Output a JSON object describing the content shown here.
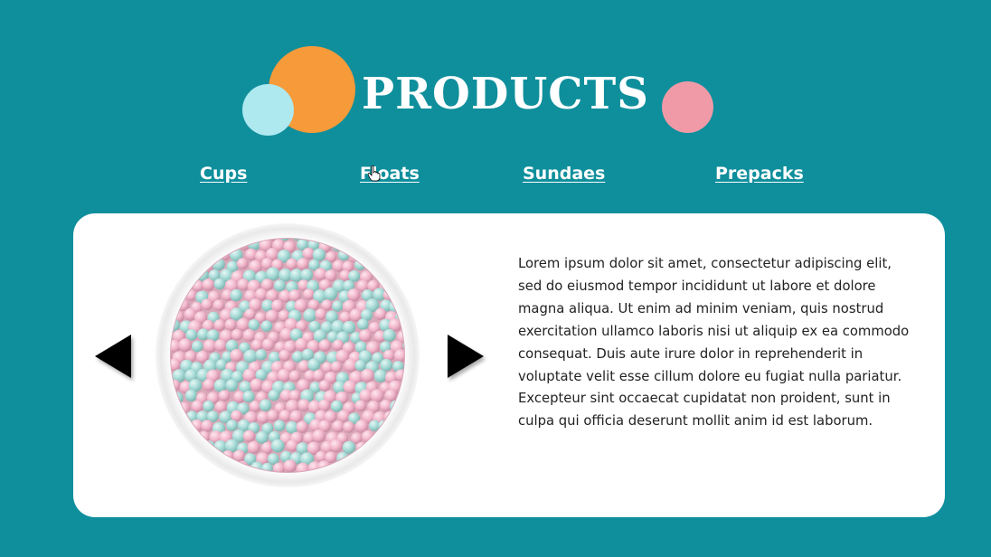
{
  "header": {
    "title": "PRODUCTS"
  },
  "nav": {
    "items": [
      {
        "label": "Cups"
      },
      {
        "label": "Floats"
      },
      {
        "label": "Sundaes"
      },
      {
        "label": "Prepacks"
      }
    ]
  },
  "product": {
    "image_icon": "ice-cream-beads-bowl",
    "description": "Lorem ipsum dolor sit amet, consectetur adipiscing elit, sed do eiusmod tempor incididunt ut labore et dolore magna aliqua. Ut enim ad minim veniam, quis nostrud exercitation ullamco laboris nisi ut aliquip ex ea commodo consequat. Duis aute irure dolor in reprehenderit in voluptate velit esse cillum dolore eu fugiat nulla pariatur. Excepteur sint occaecat cupidatat non proident, sunt in culpa qui officia deserunt mollit anim id est laborum."
  },
  "carousel": {
    "prev_icon": "triangle-left-icon",
    "next_icon": "triangle-right-icon"
  },
  "colors": {
    "background": "#0f8f9c",
    "card": "#ffffff",
    "orange_circle": "#f69a3a",
    "blue_circle": "#aee9f0",
    "pink_circle": "#f19aa7",
    "bead_pink": "#f2b8cc",
    "bead_teal": "#a9dcd8"
  }
}
